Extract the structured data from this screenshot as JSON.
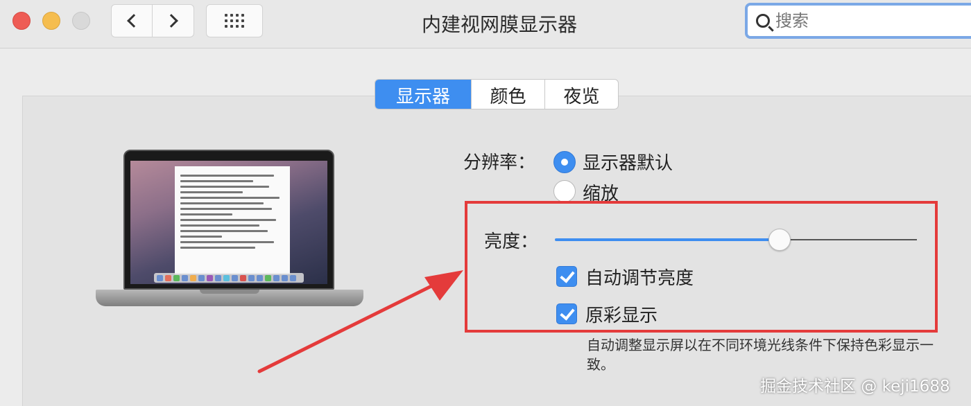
{
  "window": {
    "title": "内建视网膜显示器"
  },
  "search": {
    "placeholder": "搜索"
  },
  "tabs": [
    {
      "label": "显示器",
      "selected": true
    },
    {
      "label": "颜色",
      "selected": false
    },
    {
      "label": "夜览",
      "selected": false
    }
  ],
  "resolution": {
    "label": "分辨率：",
    "options": [
      {
        "label": "显示器默认",
        "selected": true
      },
      {
        "label": "缩放",
        "selected": false
      }
    ]
  },
  "brightness": {
    "label": "亮度：",
    "value_percent": 62,
    "auto_adjust": {
      "label": "自动调节亮度",
      "checked": true
    },
    "true_tone": {
      "label": "原彩显示",
      "checked": true
    }
  },
  "description": "自动调整显示屏以在不同环境光线条件下保持色彩显示一致。",
  "watermark": "掘金技术社区 @ keji1688",
  "colors": {
    "accent": "#3e8ef0",
    "highlight": "#e43b3b"
  }
}
